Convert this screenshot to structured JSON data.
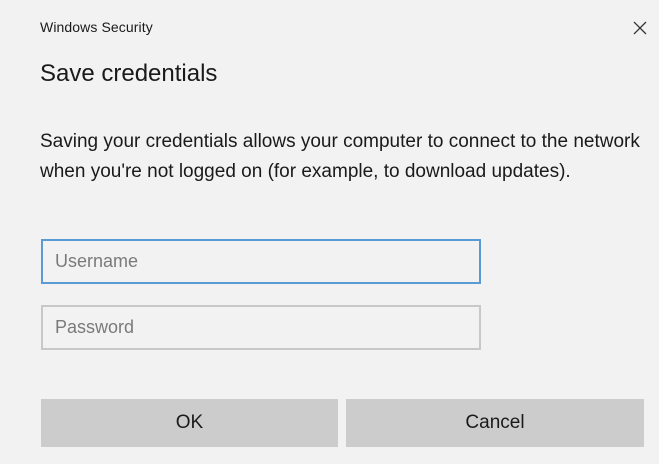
{
  "window": {
    "title": "Windows Security",
    "close_icon": "close-icon"
  },
  "dialog": {
    "heading": "Save credentials",
    "description": "Saving your credentials allows your computer to connect to the network when you're not logged on (for example, to download updates)."
  },
  "form": {
    "username": {
      "value": "",
      "placeholder": "Username"
    },
    "password": {
      "value": "",
      "placeholder": "Password"
    }
  },
  "buttons": {
    "ok_label": "OK",
    "cancel_label": "Cancel"
  },
  "colors": {
    "background": "#f2f2f2",
    "focus_border": "#5b9bd5",
    "field_border": "#c8c8c8",
    "button_bg": "#cccccc"
  }
}
